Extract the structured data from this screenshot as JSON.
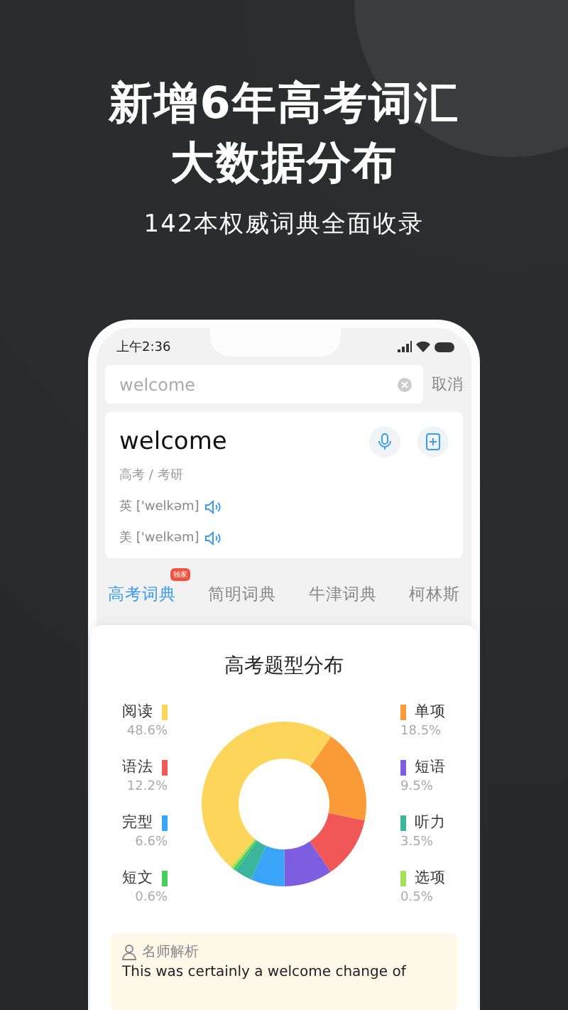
{
  "headline": {
    "lines": [
      "新增6年高考词汇",
      "大数据分布"
    ],
    "subtitle": "142本权威词典全面收录"
  },
  "phone": {
    "status_bar": {
      "time": "上午2:36"
    },
    "search": {
      "value": "welcome",
      "cancel": "取消"
    },
    "word": {
      "headword": "welcome",
      "tags": "高考 / 考研",
      "pronunciations": [
        {
          "label": "英 ['welkəm]"
        },
        {
          "label": "美 ['welkəm]"
        }
      ]
    },
    "tabs": [
      {
        "label": "高考词典",
        "selected": true,
        "badge": "独家"
      },
      {
        "label": "简明词典",
        "selected": false
      },
      {
        "label": "牛津词典",
        "selected": false
      },
      {
        "label": "柯林斯",
        "selected": false
      }
    ],
    "chart": {
      "chart_data": {
        "type": "donut",
        "title": "高考题型分布",
        "categories": [
          "阅读",
          "单项",
          "语法",
          "短语",
          "完型",
          "听力",
          "短文",
          "选项"
        ],
        "values": [
          48.6,
          18.5,
          12.2,
          9.5,
          6.6,
          3.5,
          0.6,
          0.5
        ],
        "value_labels": [
          "48.6%",
          "18.5%",
          "12.2%",
          "9.5%",
          "6.6%",
          "3.5%",
          "0.6%",
          "0.5%"
        ]
      },
      "legend": [
        {
          "color": "#fdd55a"
        },
        {
          "color": "#fb9b37"
        },
        {
          "color": "#f25757"
        },
        {
          "color": "#7e5ee0"
        },
        {
          "color": "#3aa4f8"
        },
        {
          "color": "#3bb59c"
        },
        {
          "color": "#47cc5f"
        },
        {
          "color": "#a8e05a"
        }
      ]
    },
    "analysis": {
      "title": "名师解析",
      "text": "This was certainly a welcome change of"
    }
  }
}
